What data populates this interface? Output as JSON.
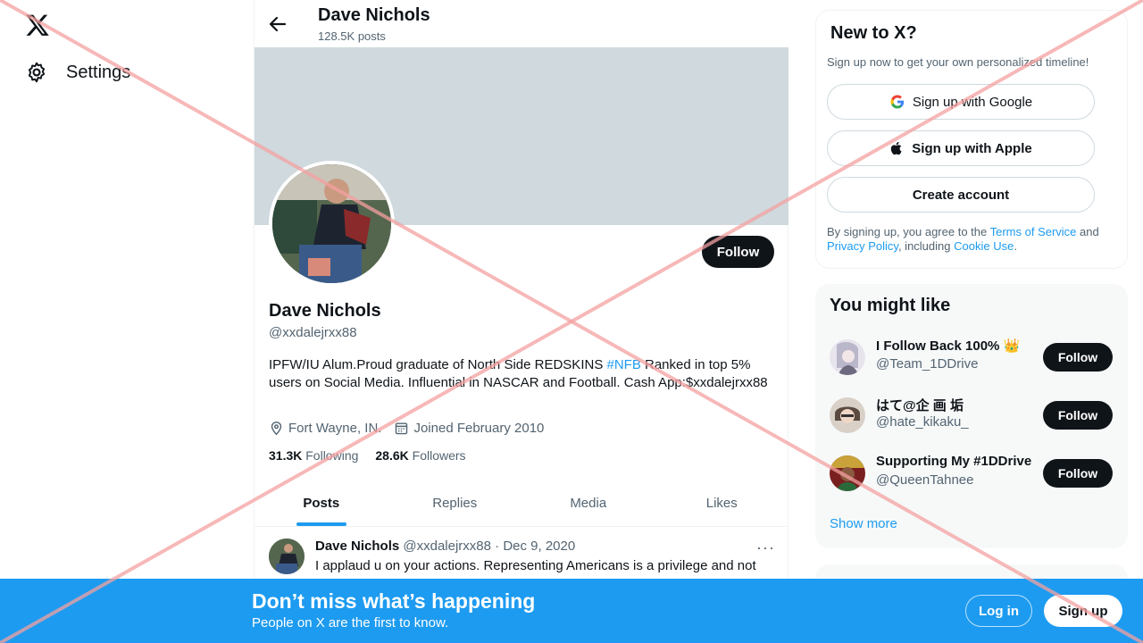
{
  "nav": {
    "settings_label": "Settings"
  },
  "header": {
    "name": "Dave Nichols",
    "post_count": "128.5K posts"
  },
  "profile": {
    "follow_label": "Follow",
    "name": "Dave Nichols",
    "handle": "@xxdalejrxx88",
    "bio_before": "IPFW/IU Alum.Proud graduate of North Side REDSKINS ",
    "bio_tag": "#NFB",
    "bio_after": " Ranked in top 5% users on Social Media. Influential in NASCAR and Football. Cash App:$xxdalejrxx88",
    "location": "Fort Wayne, IN.",
    "joined": "Joined February 2010",
    "following_count": "31.3K",
    "following_label": "Following",
    "followers_count": "28.6K",
    "followers_label": "Followers"
  },
  "tabs": [
    "Posts",
    "Replies",
    "Media",
    "Likes"
  ],
  "post": {
    "author": "Dave Nichols",
    "meta": "@xxdalejrxx88 · Dec 9, 2020",
    "more": "···",
    "text": "I applaud u on your actions. Representing Americans is a privilege and not"
  },
  "signup_card": {
    "title": "New to X?",
    "subtitle": "Sign up now to get your own personalized timeline!",
    "google": "Sign up with Google",
    "apple": "Sign up with Apple",
    "create": "Create account",
    "legal_1": "By signing up, you agree to the ",
    "terms": "Terms of Service",
    "legal_2": " and ",
    "privacy": "Privacy Policy",
    "legal_3": ", including ",
    "cookie": "Cookie Use",
    "legal_4": "."
  },
  "suggestions": {
    "title": "You might like",
    "items": [
      {
        "name": "I Follow Back 100% 👑",
        "handle": "@Team_1DDrive",
        "follow": "Follow"
      },
      {
        "name": "はて@企 画 垢",
        "handle": "@hate_kikaku_",
        "follow": "Follow"
      },
      {
        "name": "Supporting My #1DDrive",
        "handle": "@QueenTahnee",
        "follow": "Follow"
      }
    ],
    "show_more": "Show more"
  },
  "bottom": {
    "title": "Don’t miss what’s happening",
    "subtitle": "People on X are the first to know.",
    "login": "Log in",
    "signup": "Sign up"
  },
  "colors": {
    "accent": "#1d9bf0",
    "dark": "#0f1419",
    "muted": "#536471",
    "banner": "#cfd9de",
    "overlay": "#f4a0a0"
  }
}
